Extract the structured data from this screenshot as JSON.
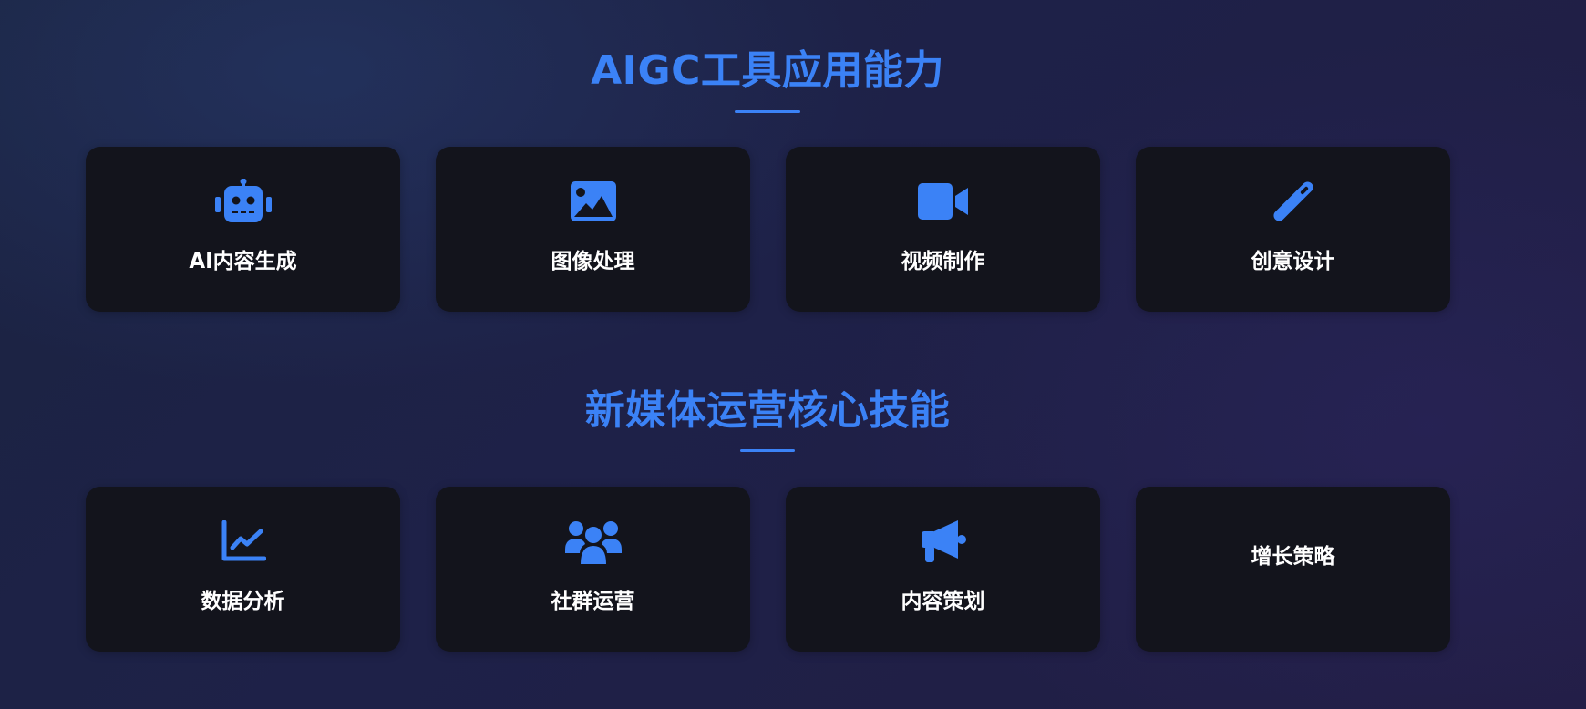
{
  "colors": {
    "accent": "#3b82f6",
    "card_bg": "#13141c",
    "text": "#ffffff"
  },
  "sections": [
    {
      "title": "AIGC工具应用能力",
      "cards": [
        {
          "label": "AI内容生成",
          "icon": "robot-icon"
        },
        {
          "label": "图像处理",
          "icon": "image-icon"
        },
        {
          "label": "视频制作",
          "icon": "video-camera-icon"
        },
        {
          "label": "创意设计",
          "icon": "pen-icon"
        }
      ]
    },
    {
      "title": "新媒体运营核心技能",
      "cards": [
        {
          "label": "数据分析",
          "icon": "line-chart-icon"
        },
        {
          "label": "社群运营",
          "icon": "users-group-icon"
        },
        {
          "label": "内容策划",
          "icon": "megaphone-icon"
        },
        {
          "label": "增长策略",
          "icon": ""
        }
      ]
    }
  ]
}
